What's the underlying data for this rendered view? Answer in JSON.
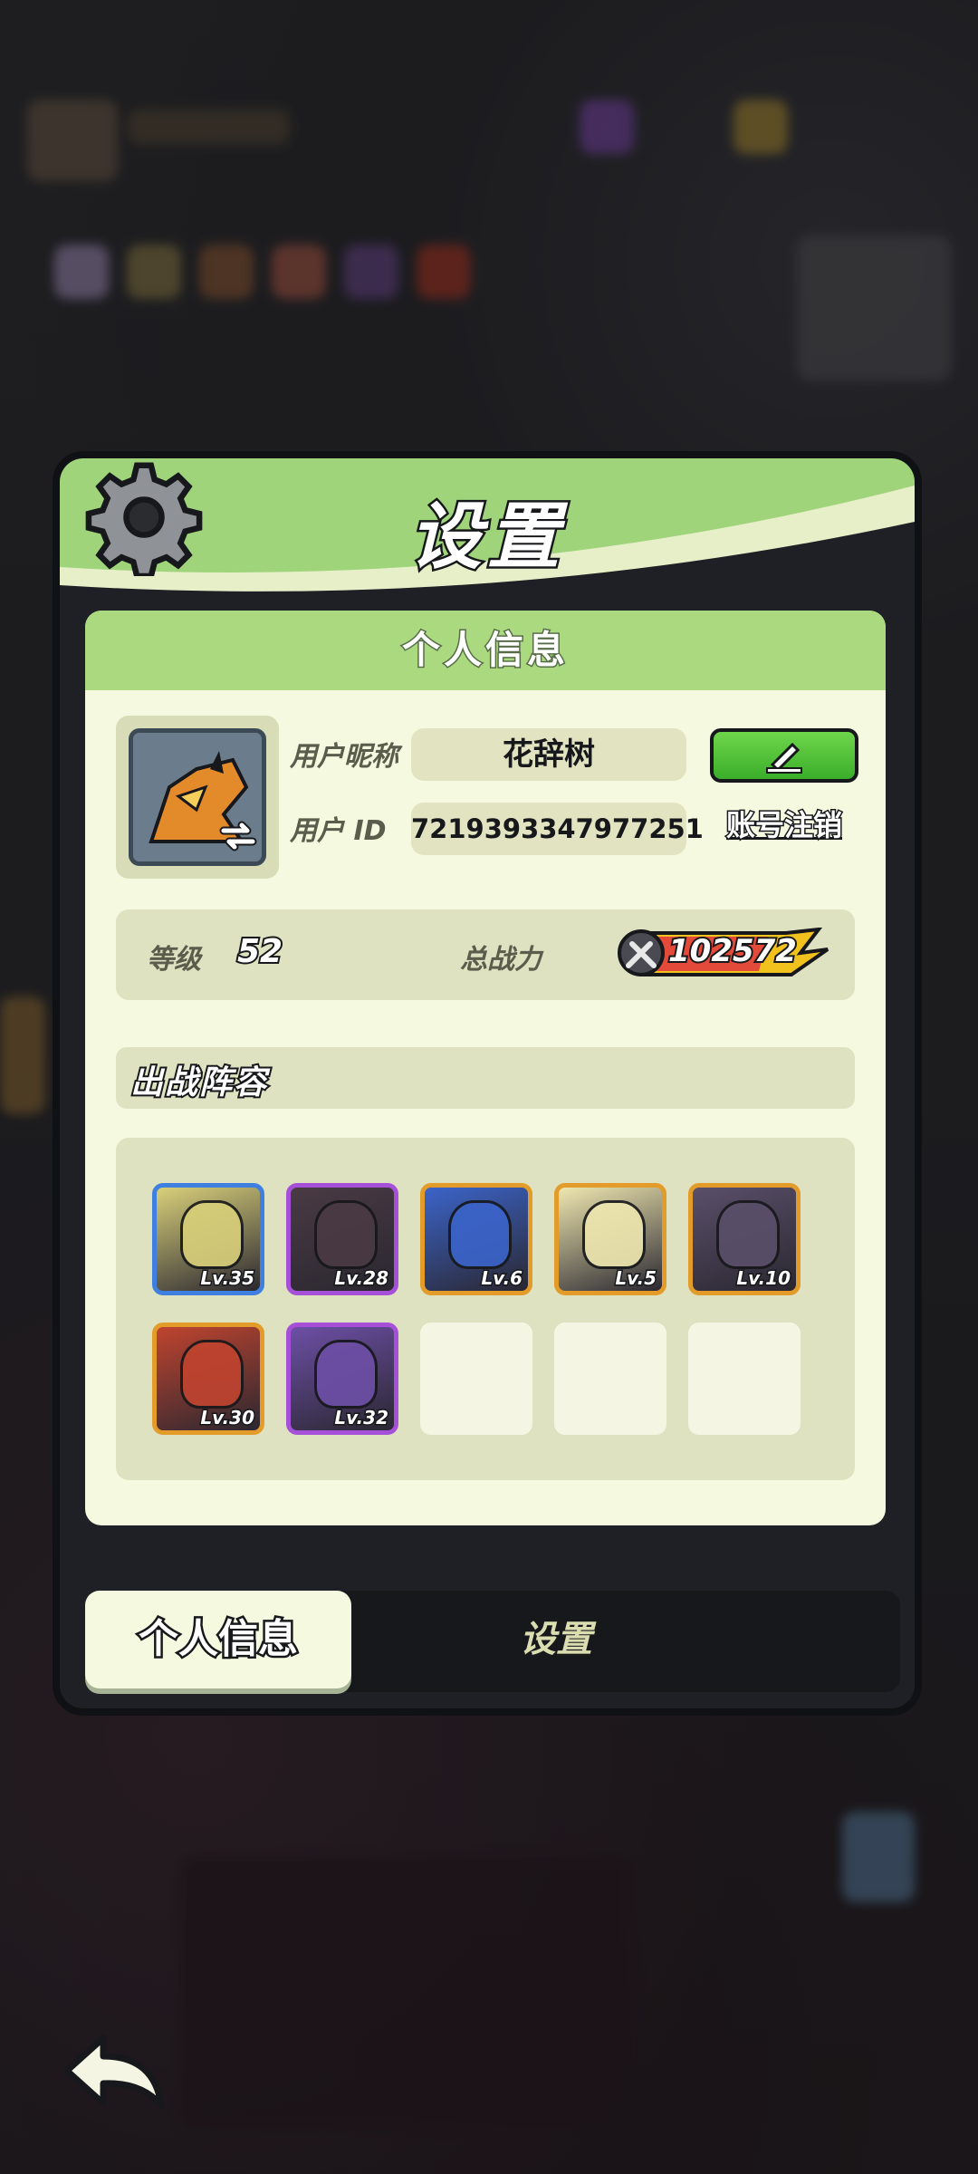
{
  "dialog": {
    "title": "设置"
  },
  "profile_section": {
    "header": "个人信息",
    "nickname_label": "用户昵称",
    "nickname": "花辞树",
    "id_label": "用户 ID",
    "user_id": "7219393347977251",
    "cancel_account_label": "账号注销",
    "level_label": "等级",
    "level": "52",
    "power_label": "总战力",
    "power": "102572"
  },
  "lineup": {
    "title": "出战阵容",
    "heroes": [
      {
        "level": "Lv.35",
        "rarity_color": "#3f7fe0",
        "art": "#d9d07a"
      },
      {
        "level": "Lv.28",
        "rarity_color": "#a64fd9",
        "art": "#4a3a44"
      },
      {
        "level": "Lv.6",
        "rarity_color": "#e39b2a",
        "art": "#3b64c9"
      },
      {
        "level": "Lv.5",
        "rarity_color": "#e39b2a",
        "art": "#efe7b0"
      },
      {
        "level": "Lv.10",
        "rarity_color": "#e39b2a",
        "art": "#5a4f6a"
      },
      {
        "level": "Lv.30",
        "rarity_color": "#e39b2a",
        "art": "#c0442f"
      },
      {
        "level": "Lv.32",
        "rarity_color": "#a64fd9",
        "art": "#6d4fa6"
      }
    ],
    "empty_slots": 3
  },
  "tabs": {
    "active": "个人信息",
    "inactive": "设置"
  },
  "colors": {
    "header_green": "#9fd47b",
    "card_bg": "#f4f9df",
    "edit_button": "#4cc136",
    "power_flame": "#f1c21e"
  },
  "icons": [
    "gear-icon",
    "pencil-icon",
    "swap-icon",
    "sword-icon",
    "back-arrow-icon"
  ]
}
